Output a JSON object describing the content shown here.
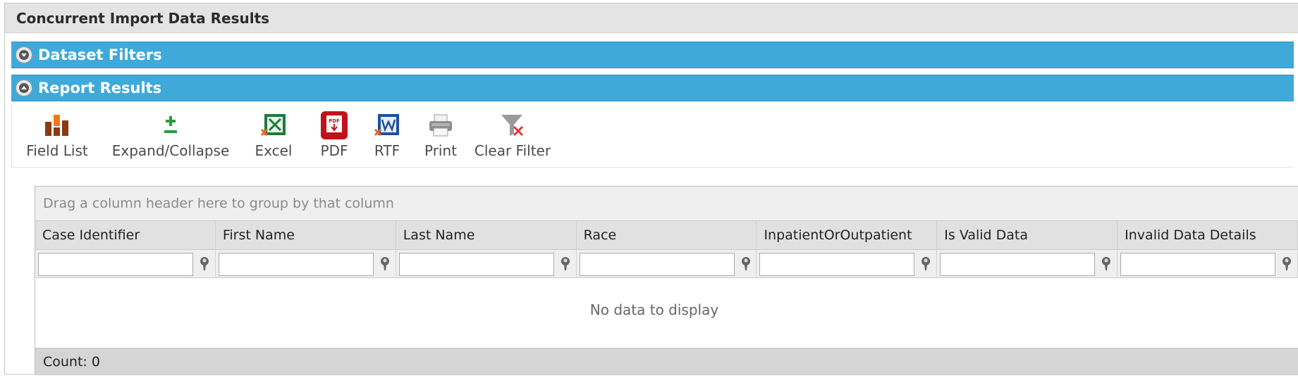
{
  "panel": {
    "title": "Concurrent Import Data Results"
  },
  "sections": {
    "filters": {
      "label": "Dataset Filters",
      "state": "collapsed"
    },
    "results": {
      "label": "Report Results",
      "state": "expanded"
    }
  },
  "toolbar": {
    "field_list": "Field List",
    "expand_collapse": "Expand/Collapse",
    "excel": "Excel",
    "pdf": "PDF",
    "rtf": "RTF",
    "print": "Print",
    "clear_filter": "Clear Filter"
  },
  "grid": {
    "group_panel_text": "Drag a column header here to group by that column",
    "columns": [
      "Case Identifier",
      "First Name",
      "Last Name",
      "Race",
      "InpatientOrOutpatient",
      "Is Valid Data",
      "Invalid Data Details"
    ],
    "empty_text": "No data to display",
    "footer": "Count: 0"
  },
  "colors": {
    "section_bar": "#3fa9d9",
    "title_bg": "#e4e4e4"
  }
}
